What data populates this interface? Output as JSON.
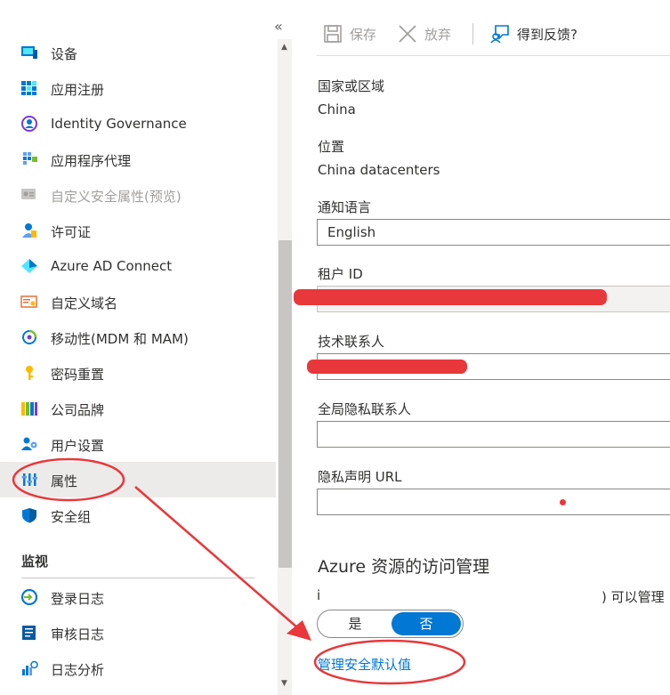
{
  "nav": {
    "collapse_glyph": "«",
    "items": [
      {
        "label": "设备",
        "icon": "device-icon"
      },
      {
        "label": "应用注册",
        "icon": "app-registrations-icon"
      },
      {
        "label": "Identity Governance",
        "icon": "identity-governance-icon"
      },
      {
        "label": "应用程序代理",
        "icon": "app-proxy-icon"
      },
      {
        "label": "自定义安全属性(预览)",
        "icon": "custom-security-attributes-icon"
      },
      {
        "label": "许可证",
        "icon": "licenses-icon"
      },
      {
        "label": "Azure AD Connect",
        "icon": "azure-ad-connect-icon"
      },
      {
        "label": "自定义域名",
        "icon": "custom-domain-icon"
      },
      {
        "label": "移动性(MDM 和 MAM)",
        "icon": "mobility-icon"
      },
      {
        "label": "密码重置",
        "icon": "password-reset-icon"
      },
      {
        "label": "公司品牌",
        "icon": "company-branding-icon"
      },
      {
        "label": "用户设置",
        "icon": "user-settings-icon"
      },
      {
        "label": "属性",
        "icon": "properties-icon"
      },
      {
        "label": "安全组",
        "icon": "security-shield-icon"
      }
    ],
    "monitor_title": "监视",
    "monitor_items": [
      {
        "label": "登录日志",
        "icon": "sign-in-logs-icon"
      },
      {
        "label": "审核日志",
        "icon": "audit-logs-icon"
      },
      {
        "label": "日志分析",
        "icon": "log-analytics-icon"
      }
    ]
  },
  "toolbar": {
    "save_label": "保存",
    "discard_label": "放弃",
    "feedback_label": "得到反馈?"
  },
  "form": {
    "country_label": "国家或区域",
    "country_value": "China",
    "location_label": "位置",
    "location_value": "China datacenters",
    "language_label": "通知语言",
    "language_value": "English",
    "tenant_label": "租户 ID",
    "tech_contact_label": "技术联系人",
    "privacy_contact_label": "全局隐私联系人",
    "privacy_url_label": "隐私声明 URL",
    "azure_title": "Azure 资源的访问管理",
    "partial_left": "i",
    "partial_right": ") 可以管理",
    "toggle_yes": "是",
    "toggle_no": "否",
    "manage_link": "管理安全默认值"
  },
  "annotation": {
    "color": "#e8383b"
  }
}
